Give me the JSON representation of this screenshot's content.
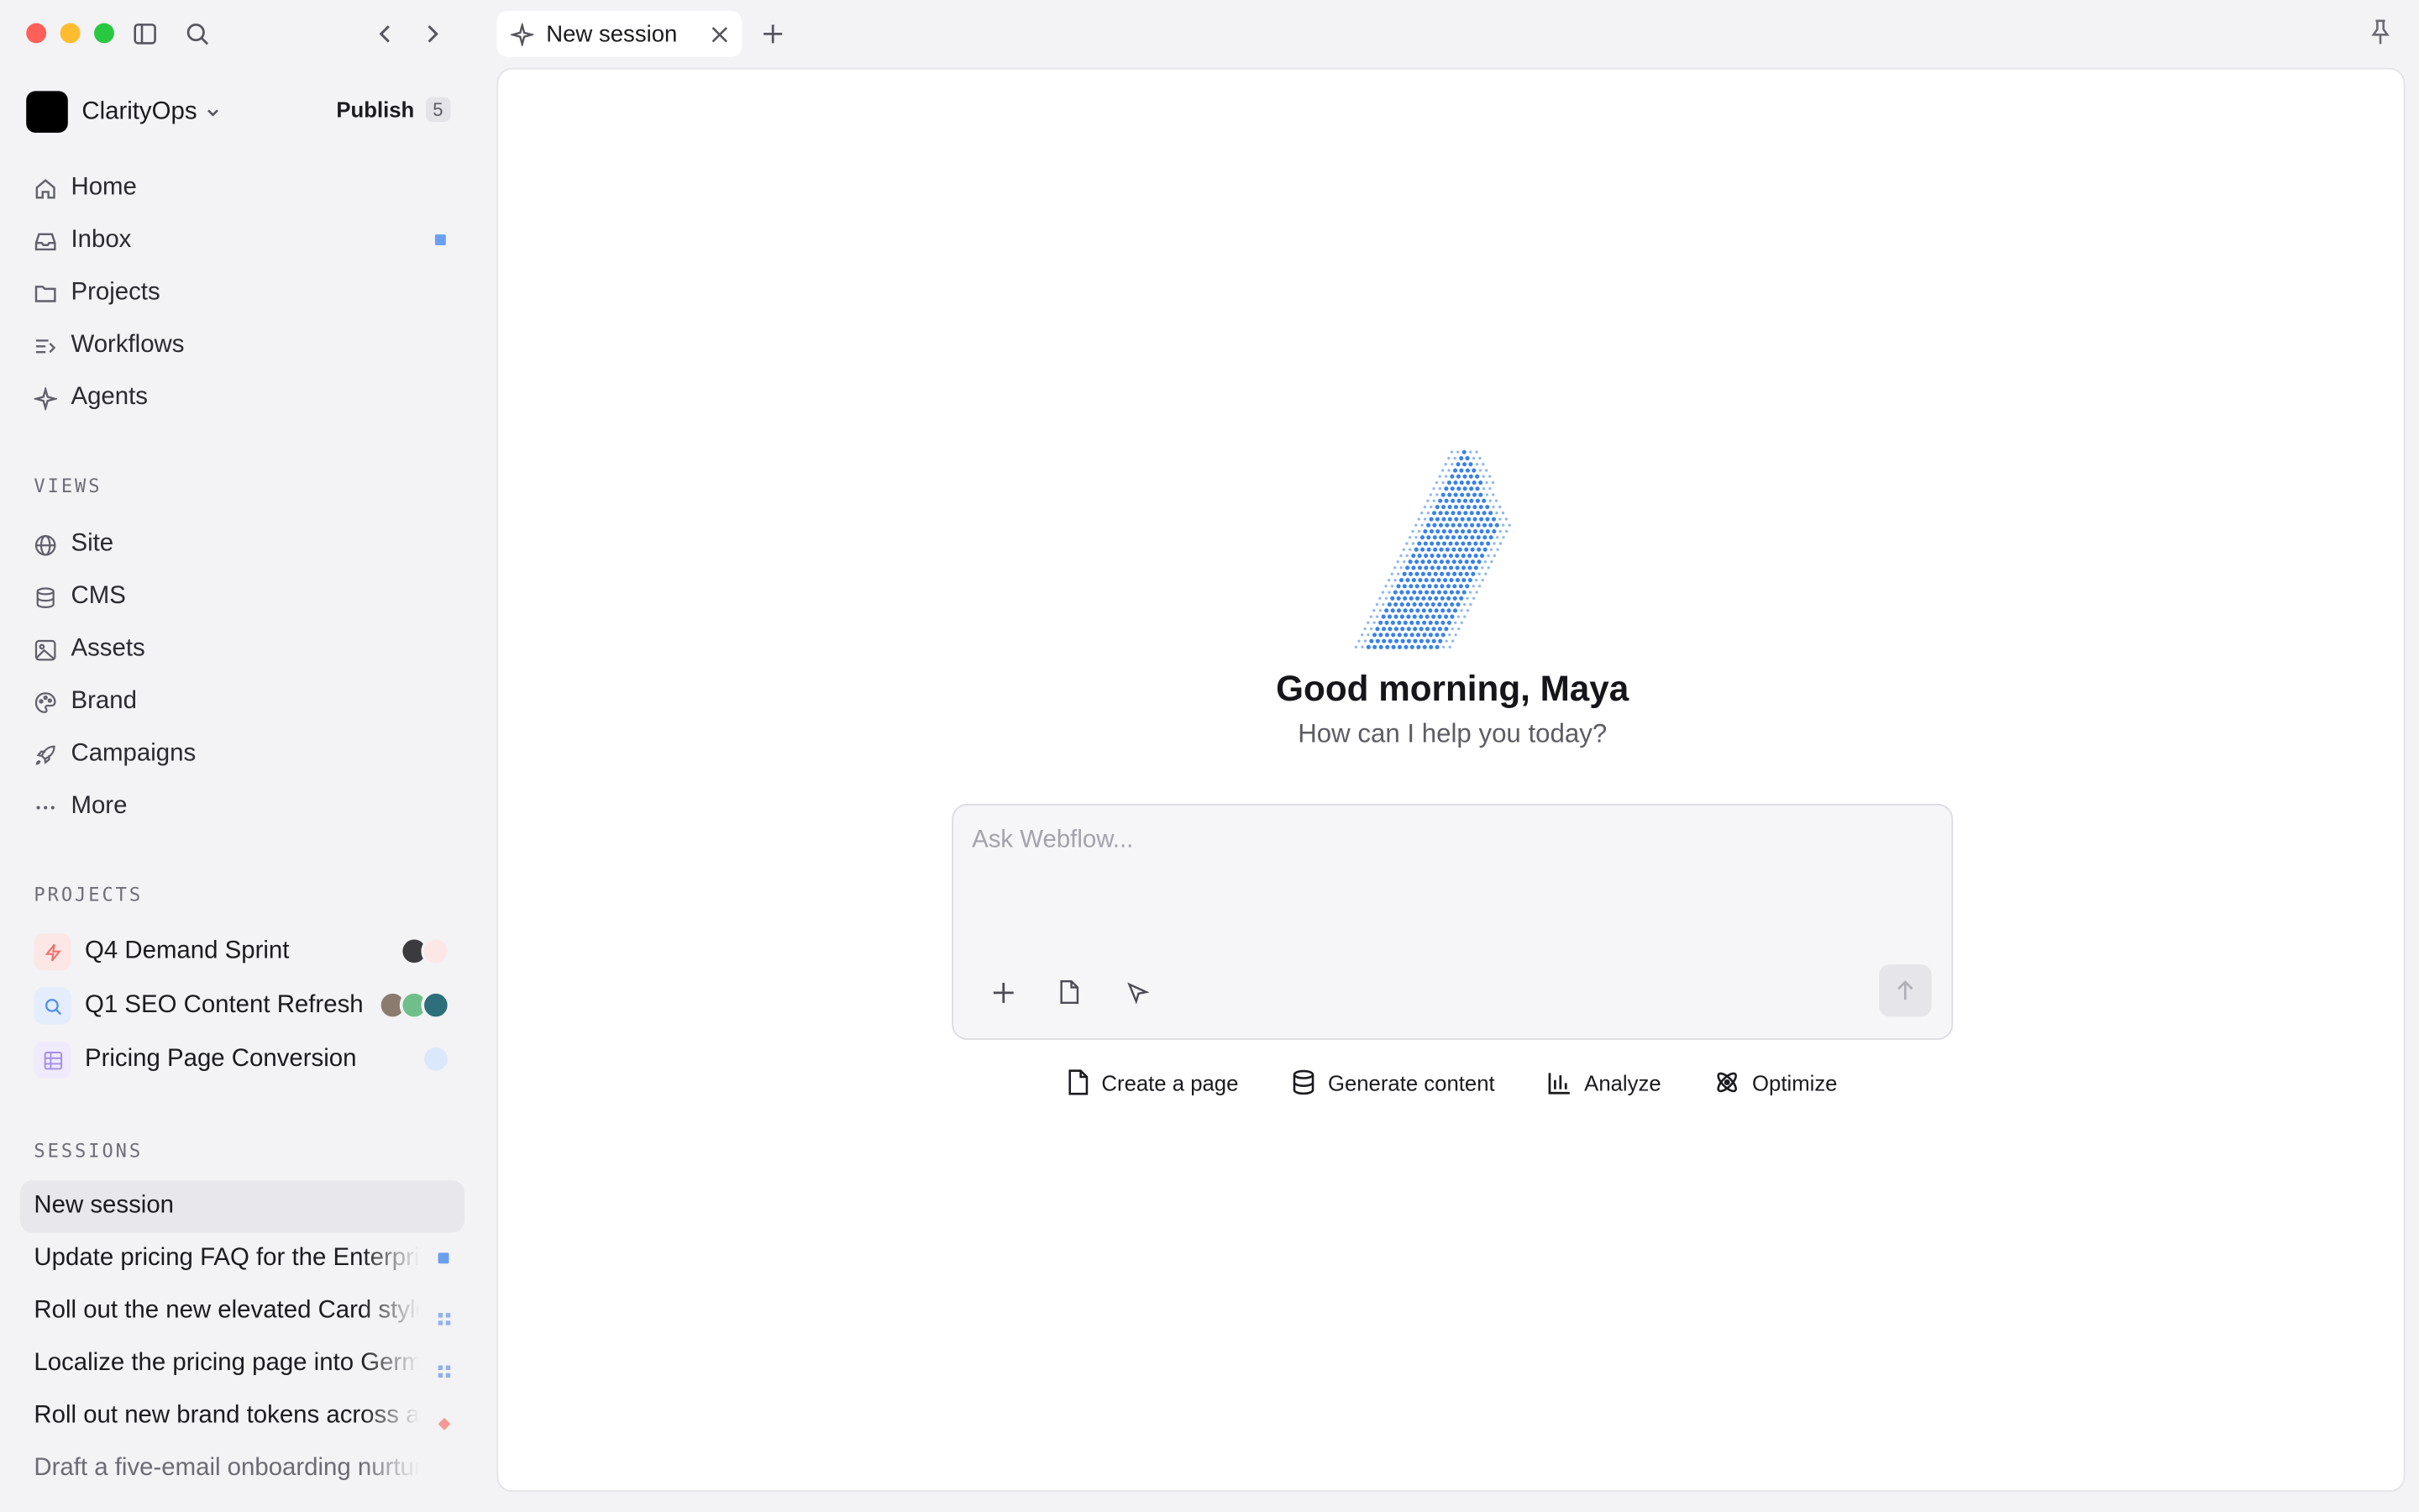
{
  "window": {
    "tab_label": "New session",
    "tab_icon": "sparkle-icon"
  },
  "workspace": {
    "name": "ClarityOps",
    "publish_label": "Publish",
    "publish_count": "5"
  },
  "nav": [
    {
      "label": "Home",
      "icon": "home-icon"
    },
    {
      "label": "Inbox",
      "icon": "inbox-icon",
      "unread": true
    },
    {
      "label": "Projects",
      "icon": "folder-icon"
    },
    {
      "label": "Workflows",
      "icon": "workflows-icon"
    },
    {
      "label": "Agents",
      "icon": "sparkle-icon"
    }
  ],
  "views": {
    "label": "VIEWS",
    "items": [
      {
        "label": "Site",
        "icon": "globe-icon"
      },
      {
        "label": "CMS",
        "icon": "database-icon"
      },
      {
        "label": "Assets",
        "icon": "image-icon"
      },
      {
        "label": "Brand",
        "icon": "palette-icon"
      },
      {
        "label": "Campaigns",
        "icon": "rocket-icon"
      },
      {
        "label": "More",
        "icon": "more-icon"
      }
    ]
  },
  "projects": {
    "label": "PROJECTS",
    "items": [
      {
        "label": "Q4 Demand Sprint",
        "icon": "bolt-icon",
        "color": "#f0706a"
      },
      {
        "label": "Q1 SEO Content Refresh",
        "icon": "search-icon",
        "color": "#4f8de8"
      },
      {
        "label": "Pricing Page Conversion",
        "icon": "grid-icon",
        "color": "#a48ee8"
      }
    ]
  },
  "sessions": {
    "label": "SESSIONS",
    "items": [
      {
        "label": "New session",
        "active": true
      },
      {
        "label": "Update pricing FAQ for the Enterprise plan",
        "marker": "#6a9ff0"
      },
      {
        "label": "Roll out the new elevated Card style",
        "marker": "#8fb2f0"
      },
      {
        "label": "Localize the pricing page into German",
        "marker": "#8fb2f0"
      },
      {
        "label": "Roll out new brand tokens across all pages",
        "marker": "#f59a92"
      },
      {
        "label": "Draft a five-email onboarding nurture"
      }
    ]
  },
  "main": {
    "greeting": "Good morning, Maya",
    "subtitle": "How can I help you today?",
    "composer_placeholder": "Ask Webflow...",
    "actions": [
      {
        "label": "Create a page",
        "icon": "file-icon"
      },
      {
        "label": "Generate content",
        "icon": "database-icon"
      },
      {
        "label": "Analyze",
        "icon": "bar-chart-icon"
      },
      {
        "label": "Optimize",
        "icon": "atom-icon"
      }
    ]
  }
}
